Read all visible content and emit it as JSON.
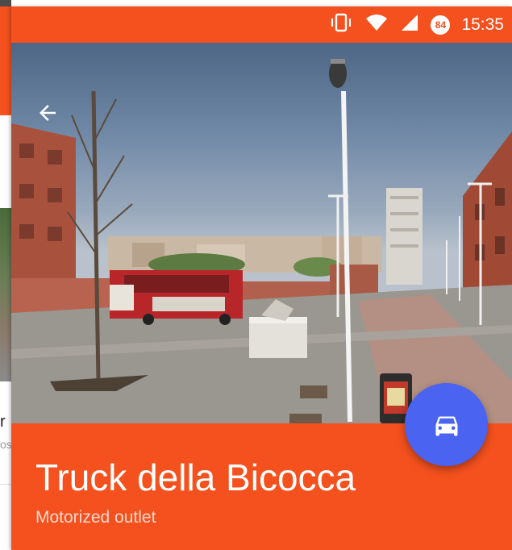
{
  "status_bar": {
    "time": "15:35",
    "battery_level": "84",
    "icons": [
      "vibrate-icon",
      "wifi-icon",
      "cellular-signal-icon",
      "battery-saver-icon"
    ]
  },
  "background_app": {
    "text_fragment_1": "r",
    "text_fragment_2": "os"
  },
  "place": {
    "name": "Truck della Bicocca",
    "category": "Motorized outlet"
  },
  "actions": {
    "back_icon": "arrow-back-icon",
    "directions_icon": "car-icon"
  },
  "colors": {
    "accent": "#f4511e",
    "fab": "#4a63f0"
  }
}
